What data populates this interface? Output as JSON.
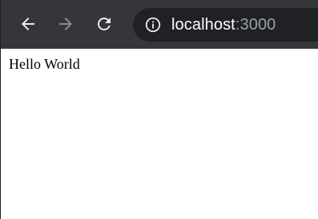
{
  "toolbar": {
    "back_icon": "arrow-left-icon",
    "forward_icon": "arrow-right-icon",
    "reload_icon": "reload-icon",
    "info_icon": "info-circle-icon"
  },
  "address_bar": {
    "host": "localhost",
    "port": ":3000"
  },
  "page": {
    "body_text": "Hello World"
  },
  "colors": {
    "toolbar_bg": "#35363a",
    "omnibox_bg": "#202124",
    "icon_active": "#e8eaed",
    "icon_disabled": "#8a8c90"
  }
}
